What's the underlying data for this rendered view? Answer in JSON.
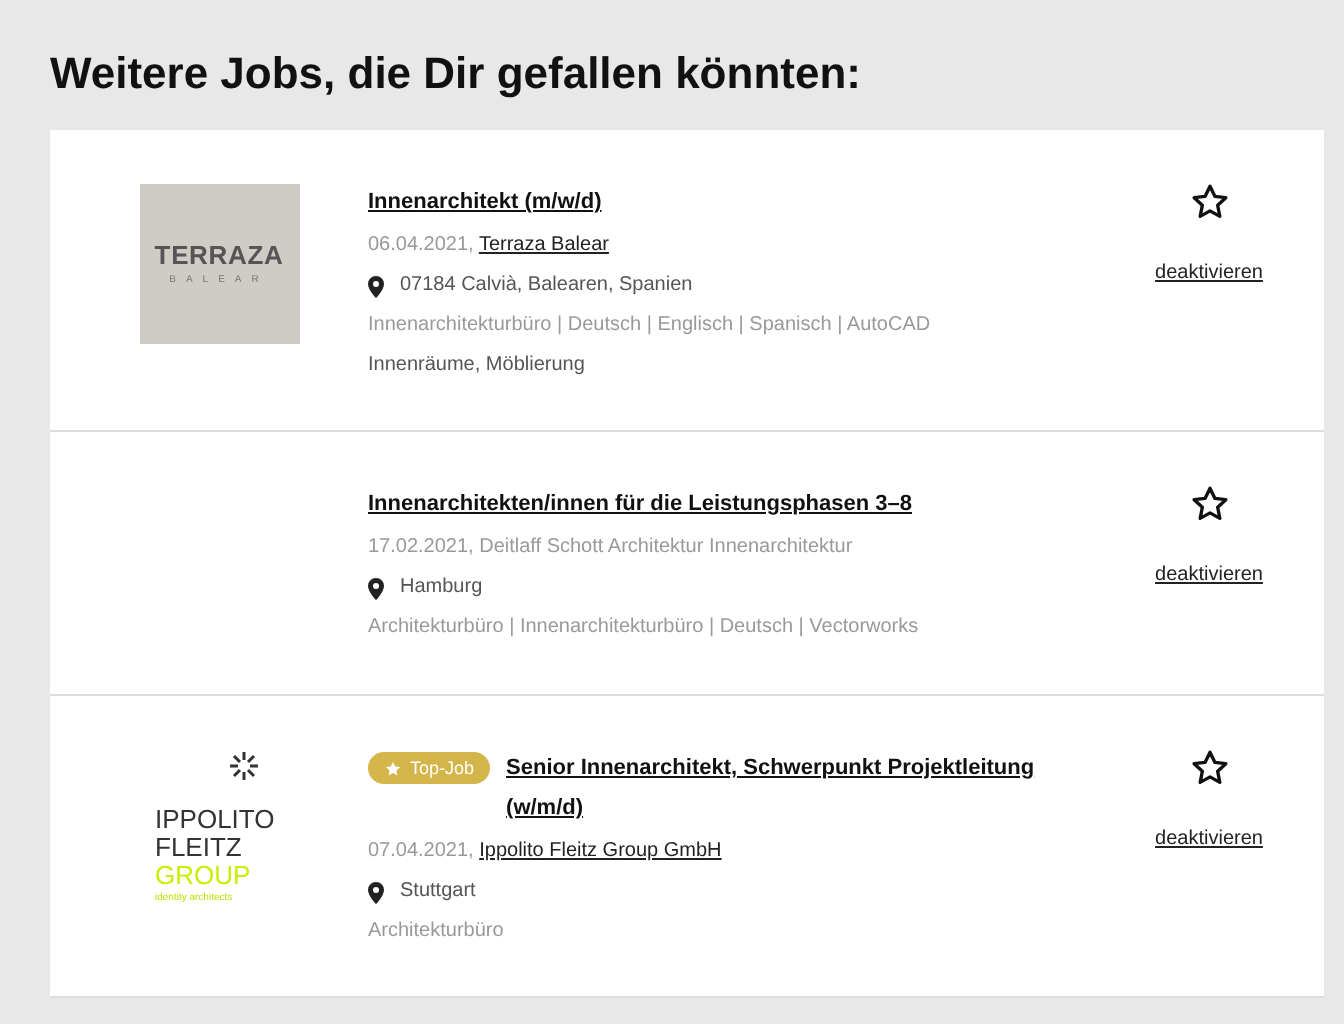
{
  "heading": "Weitere Jobs, die Dir gefallen könnten:",
  "jobs": [
    {
      "logo": {
        "kind": "terraza",
        "lines": [
          "TERRAZA",
          "BALEAR"
        ]
      },
      "title": "Innenarchitekt (m/w/d)",
      "date": "06.04.2021,",
      "company": "Terraza Balear",
      "company_link": true,
      "location": "07184 Calvià, Balearen, Spanien",
      "tags": "Innenarchitekturbüro | Deutsch | Englisch | Spanisch | AutoCAD",
      "extra": "Innenräume, Möblierung",
      "favorite": false,
      "action": "deaktivieren"
    },
    {
      "logo": {
        "kind": "none"
      },
      "title": "Innenarchitekten/innen für die Leistungsphasen 3–8",
      "date": "17.02.2021,",
      "company": "Deitlaff Schott Architektur Innenarchitektur",
      "company_link": false,
      "location": "Hamburg",
      "tags": "Architekturbüro | Innenarchitekturbüro | Deutsch | Vectorworks",
      "favorite": false,
      "action": "deaktivieren"
    },
    {
      "logo": {
        "kind": "ippolito",
        "lines": [
          "IPPOLITO",
          "FLEITZ",
          "GROUP",
          "identity architects"
        ]
      },
      "badge": "Top-Job",
      "title": "Senior Innenarchitekt, Schwerpunkt Projektleitung (w/m/d)",
      "date": "07.04.2021,",
      "company": "Ippolito Fleitz Group GmbH",
      "company_link": true,
      "location": "Stuttgart",
      "tags": "Architekturbüro",
      "favorite": false,
      "action": "deaktivieren"
    }
  ]
}
